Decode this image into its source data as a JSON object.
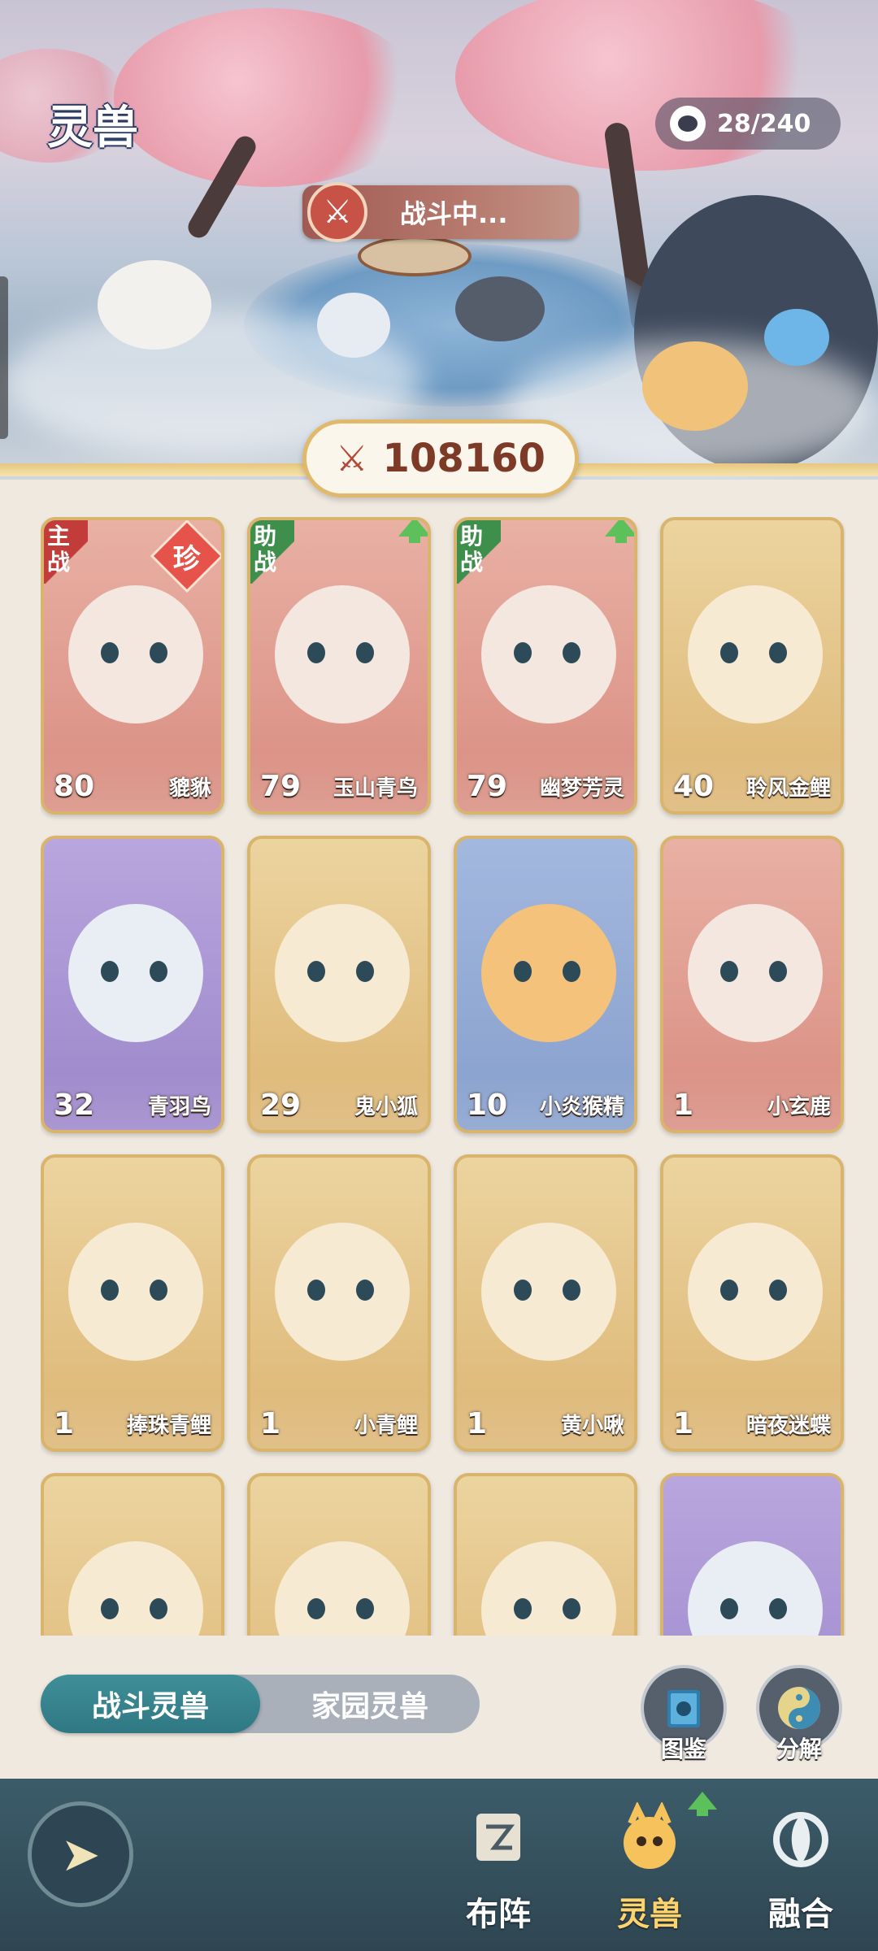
{
  "header": {
    "title": "灵兽",
    "capacity": "28/240",
    "battle_status": "战斗中...",
    "power": "108160"
  },
  "cards": [
    {
      "level": "80",
      "name": "貔貅",
      "role": "主战",
      "rare": "珍",
      "bg": "red",
      "upgrade": false
    },
    {
      "level": "79",
      "name": "玉山青鸟",
      "role": "助战",
      "rare": "",
      "bg": "red",
      "upgrade": true
    },
    {
      "level": "79",
      "name": "幽梦芳灵",
      "role": "助战",
      "rare": "",
      "bg": "red",
      "upgrade": true
    },
    {
      "level": "40",
      "name": "聆风金鲤",
      "role": "",
      "rare": "",
      "bg": "gold",
      "upgrade": false
    },
    {
      "level": "32",
      "name": "青羽鸟",
      "role": "",
      "rare": "",
      "bg": "purple",
      "upgrade": false
    },
    {
      "level": "29",
      "name": "鬼小狐",
      "role": "",
      "rare": "",
      "bg": "gold",
      "upgrade": false
    },
    {
      "level": "10",
      "name": "小炎猴精",
      "role": "",
      "rare": "",
      "bg": "blue",
      "upgrade": false
    },
    {
      "level": "1",
      "name": "小玄鹿",
      "role": "",
      "rare": "",
      "bg": "red",
      "upgrade": false
    },
    {
      "level": "1",
      "name": "捧珠青鲤",
      "role": "",
      "rare": "",
      "bg": "gold",
      "upgrade": false
    },
    {
      "level": "1",
      "name": "小青鲤",
      "role": "",
      "rare": "",
      "bg": "gold",
      "upgrade": false
    },
    {
      "level": "1",
      "name": "黄小啾",
      "role": "",
      "rare": "",
      "bg": "gold",
      "upgrade": false
    },
    {
      "level": "1",
      "name": "暗夜迷蝶",
      "role": "",
      "rare": "",
      "bg": "gold",
      "upgrade": false
    },
    {
      "level": "",
      "name": "",
      "role": "",
      "rare": "",
      "bg": "gold",
      "upgrade": false
    },
    {
      "level": "",
      "name": "",
      "role": "",
      "rare": "",
      "bg": "gold",
      "upgrade": false
    },
    {
      "level": "",
      "name": "",
      "role": "",
      "rare": "",
      "bg": "gold",
      "upgrade": false
    },
    {
      "level": "",
      "name": "",
      "role": "",
      "rare": "",
      "bg": "purple",
      "upgrade": false
    }
  ],
  "tabs": [
    {
      "label": "战斗灵兽",
      "active": true
    },
    {
      "label": "家园灵兽",
      "active": false
    }
  ],
  "tools": {
    "codex_label": "图鉴",
    "decompose_label": "分解"
  },
  "nav": {
    "items": [
      {
        "label": "布阵",
        "active": false,
        "icon": "scroll-icon"
      },
      {
        "label": "灵兽",
        "active": true,
        "icon": "spirit-beast-icon"
      },
      {
        "label": "融合",
        "active": false,
        "icon": "fusion-icon"
      }
    ]
  },
  "colors": {
    "accent_teal": "#2f7883",
    "gold_border": "#d9b46c",
    "power_text": "#7c3a27",
    "upgrade_green": "#5cc15a"
  }
}
